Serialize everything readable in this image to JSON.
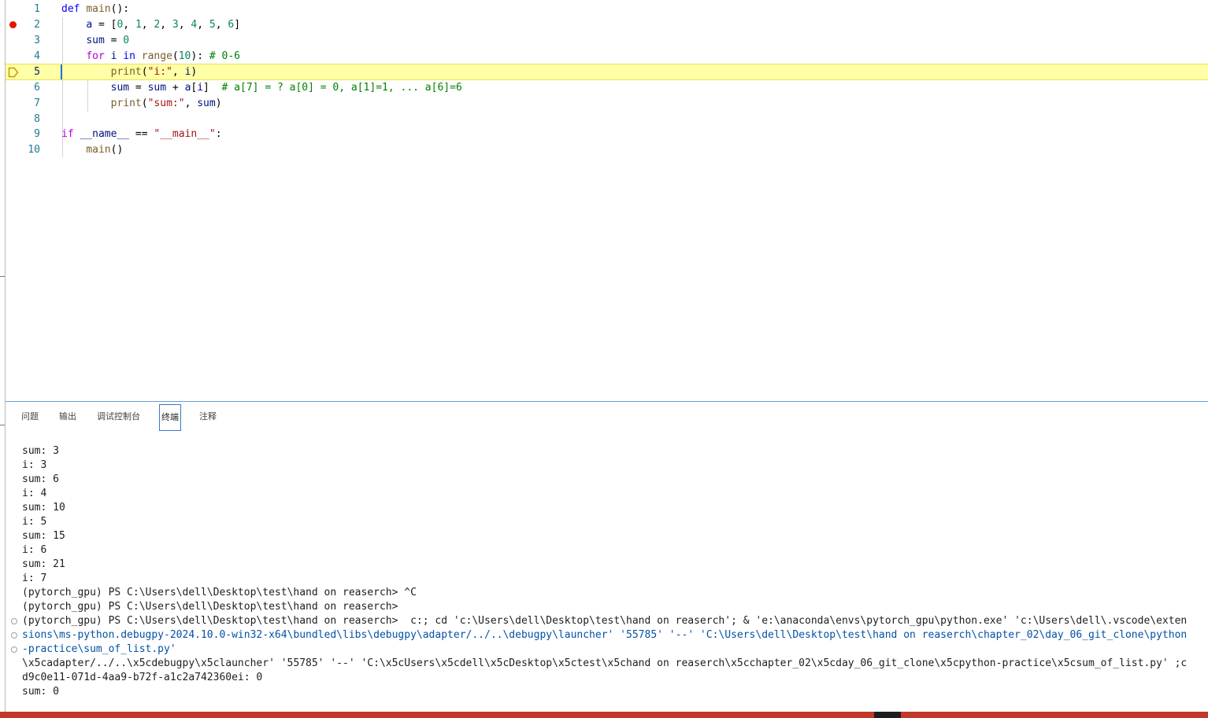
{
  "editor": {
    "lines": [
      {
        "num": "1",
        "code": "def main():"
      },
      {
        "num": "2",
        "code": "    a = [0, 1, 2, 3, 4, 5, 6]",
        "breakpoint": true
      },
      {
        "num": "3",
        "code": "    sum = 0"
      },
      {
        "num": "4",
        "code": "    for i in range(10): # 0-6"
      },
      {
        "num": "5",
        "code": "        print(\"i:\", i)",
        "current": true
      },
      {
        "num": "6",
        "code": "        sum = sum + a[i]  # a[7] = ? a[0] = 0, a[1]=1, ... a[6]=6"
      },
      {
        "num": "7",
        "code": "        print(\"sum:\", sum)"
      },
      {
        "num": "8",
        "code": ""
      },
      {
        "num": "9",
        "code": "if __name__ == \"__main__\":"
      },
      {
        "num": "10",
        "code": "    main()"
      }
    ]
  },
  "panel": {
    "tabs": [
      {
        "label": "问题"
      },
      {
        "label": "输出"
      },
      {
        "label": "调试控制台"
      },
      {
        "label": "终端",
        "active": true
      },
      {
        "label": "注释"
      }
    ]
  },
  "terminal": {
    "lines": [
      "sum: 3",
      "i: 3",
      "sum: 6",
      "i: 4",
      "sum: 10",
      "i: 5",
      "sum: 15",
      "i: 6",
      "sum: 21",
      "i: 7",
      "(pytorch_gpu) PS C:\\Users\\dell\\Desktop\\test\\hand on reaserch> ^C",
      "(pytorch_gpu) PS C:\\Users\\dell\\Desktop\\test\\hand on reaserch>",
      "(pytorch_gpu) PS C:\\Users\\dell\\Desktop\\test\\hand on reaserch>  c:; cd 'c:\\Users\\dell\\Desktop\\test\\hand on reaserch'; & 'e:\\anaconda\\envs\\pytorch_gpu\\python.exe' 'c:\\Users\\dell\\.vscode\\exten",
      "sions\\ms-python.debugpy-2024.10.0-win32-x64\\bundled\\libs\\debugpy\\adapter/../..\\debugpy\\launcher' '55785' '--' 'C:\\Users\\dell\\Desktop\\test\\hand on reaserch\\chapter_02\\day_06_git_clone\\python",
      "-practice\\sum_of_list.py'",
      "\\x5cadapter/../..\\x5cdebugpy\\x5clauncher' '55785' '--' 'C:\\x5cUsers\\x5cdell\\x5cDesktop\\x5ctest\\x5chand on reaserch\\x5cchapter_02\\x5cday_06_git_clone\\x5cpython-practice\\x5csum_of_list.py' ;c",
      "d9c0e11-071d-4aa9-b72f-a1c2a742360ei: 0",
      "sum: 0"
    ]
  },
  "colors": {
    "current_line_bg": "#ffffa8",
    "breakpoint": "#e51400",
    "line_number": "#237893",
    "status_bar": "#c0392b"
  }
}
